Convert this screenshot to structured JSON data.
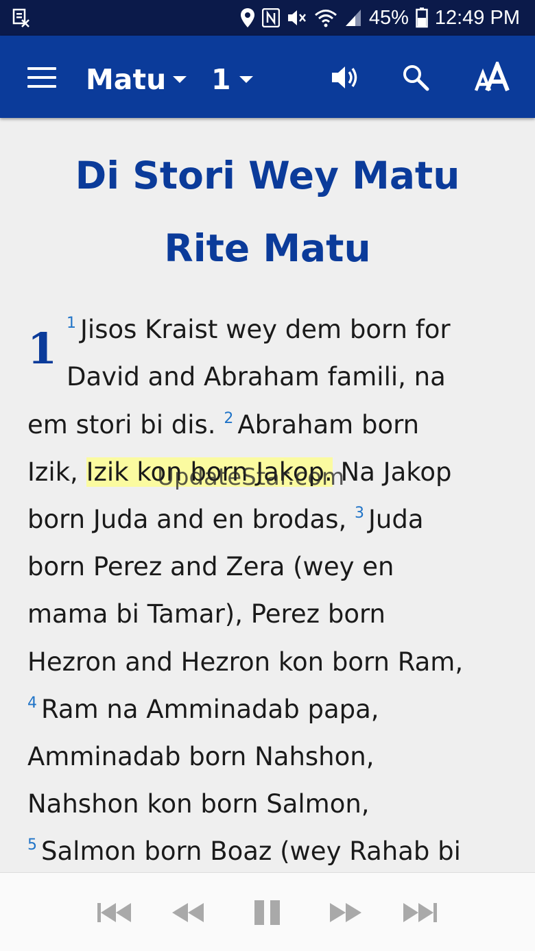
{
  "status_bar": {
    "battery": "45%",
    "time": "12:49 PM",
    "icons": [
      "notification-icon",
      "location-icon",
      "nfc-icon",
      "mute-icon",
      "wifi-icon",
      "signal-icon",
      "battery-icon"
    ]
  },
  "app_bar": {
    "book": "Matu",
    "chapter": "1",
    "icons": [
      "menu-icon",
      "speaker-icon",
      "search-icon",
      "text-size-icon"
    ]
  },
  "content": {
    "title_line1": "Di Stori Wey Matu",
    "title_line2": "Rite Matu",
    "chapter_number": "1",
    "lines": [
      {
        "v": "1",
        "t": "Jisos Kraist wey dem born for"
      },
      {
        "t": "David and Abraham famili, na"
      },
      {
        "pre": "em stori bi dis. ",
        "v": "2",
        "t": "Abraham born"
      },
      {
        "pre": "Izik, ",
        "hl": "Izik kon born Jakop.",
        "t": " Na Jakop"
      },
      {
        "pre": "born Juda and en brodas, ",
        "v": "3",
        "t": "Juda"
      },
      {
        "t": "born Perez and Zera (wey en"
      },
      {
        "t": "mama bi Tamar), Perez born"
      },
      {
        "t": "Hezron and Hezron kon born Ram,"
      },
      {
        "v": "4",
        "t": "Ram na Amminadab papa,"
      },
      {
        "t": "Amminadab born Nahshon,"
      },
      {
        "t": "Nahshon kon born Salmon,"
      },
      {
        "v": "5",
        "t": "Salmon born Boaz (wey Rahab bi"
      }
    ],
    "watermark": "UpdateStar.com"
  },
  "audio_controls": [
    "skip-to-start-icon",
    "rewind-icon",
    "pause-icon",
    "fast-forward-icon",
    "skip-to-end-icon"
  ],
  "colors": {
    "status_bar": "#0b1a4a",
    "app_bar": "#0b3b9a",
    "title": "#0b3b9a",
    "verse_number": "#1f73c7",
    "highlight": "#fbfba0",
    "background": "#efefef"
  }
}
